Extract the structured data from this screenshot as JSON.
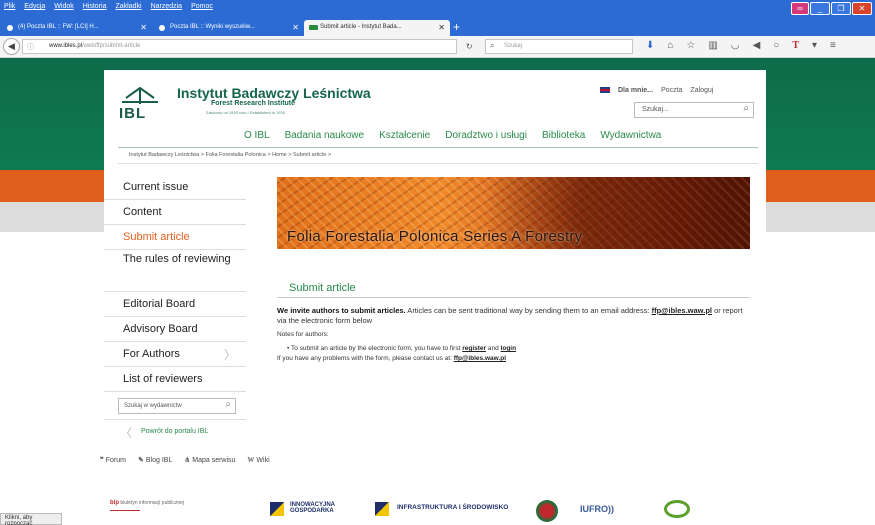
{
  "browser": {
    "menu": [
      "Plik",
      "Edycja",
      "Widok",
      "Historia",
      "Zakładki",
      "Narzędzia",
      "Pomoc"
    ],
    "tabs": [
      {
        "label": "(4) Poczta IBL :: FW: [LCI] H..."
      },
      {
        "label": "Poczta IBL :: Wyniki wyszukiw..."
      },
      {
        "label": "Submit article - Instytut Bada..."
      }
    ],
    "url_host": "www.ibles.pl",
    "url_path": "/web/ffp/submit-article",
    "search_placeholder": "Szukaj"
  },
  "header": {
    "logo_text": "IBL",
    "org_name": "Instytut Badawczy Leśnictwa",
    "org_subtitle": "Forest Research Institute",
    "org_established": "Założony od 1930 roku / Established in 1930",
    "top_links": [
      "Dla mnie...",
      "Poczta",
      "Zaloguj"
    ],
    "search_placeholder": "Szukaj..."
  },
  "main_nav": [
    "O IBL",
    "Badania naukowe",
    "Kształcenie",
    "Doradztwo i usługi",
    "Biblioteka",
    "Wydawnictwa"
  ],
  "breadcrumb": "Instytut Badawczy Leśnictwa  >  Folia Forestalia Polonica  >  Home  >  Submit article  >",
  "sidebar": {
    "items": [
      {
        "label": "Current issue"
      },
      {
        "label": "Content"
      },
      {
        "label": "Submit article"
      },
      {
        "label": "The rules of reviewing"
      },
      {
        "label": "Editorial Board"
      },
      {
        "label": "Advisory Board"
      },
      {
        "label": "For Authors"
      },
      {
        "label": "List of reviewers"
      }
    ],
    "search_placeholder": "Szukaj w wydawnictw",
    "back_label": "Powrót do portalu IBL"
  },
  "banner_title": "Folia Forestalia Polonica Series A Forestry",
  "page_title": "Submit article",
  "content": {
    "intro_bold": "We invite authors to submit articles.",
    "intro_rest_1": " Articles can be sent traditional way by sending them to an email address: ",
    "email": "ffp@ibles.waw.pl",
    "intro_rest_2": " or report via the electronic form below",
    "notes_heading": "Notes for authors:",
    "bullet_1_pre": "To submit an article by the electronic form, you have to first ",
    "register": "register",
    "and": " and ",
    "login": "login",
    "problems_pre": "If you have any problems with the form, please contact us at: ",
    "problems_email": "ffp@ibles.waw.pl"
  },
  "footer_links": [
    {
      "icon": "forum-icon",
      "label": "Forum"
    },
    {
      "icon": "blog-icon",
      "label": "Blog IBL"
    },
    {
      "icon": "sitemap-icon",
      "label": "Mapa serwisu"
    },
    {
      "icon": "wiki-icon",
      "label": "Wiki"
    }
  ],
  "partners": {
    "bip": "bip",
    "bip_text": "biuletyn informacji publicznej",
    "io": "INNOWACYJNA GOSPODARKA",
    "ris": "INFRASTRUKTURA I ŚRODOWISKO",
    "iufro": "IUFRO"
  },
  "status_text": "Klikni, aby rozpocząć",
  "colors": {
    "brand_green": "#0f7a52",
    "accent_orange": "#e05f1c",
    "link_green": "#2a8a4a"
  }
}
